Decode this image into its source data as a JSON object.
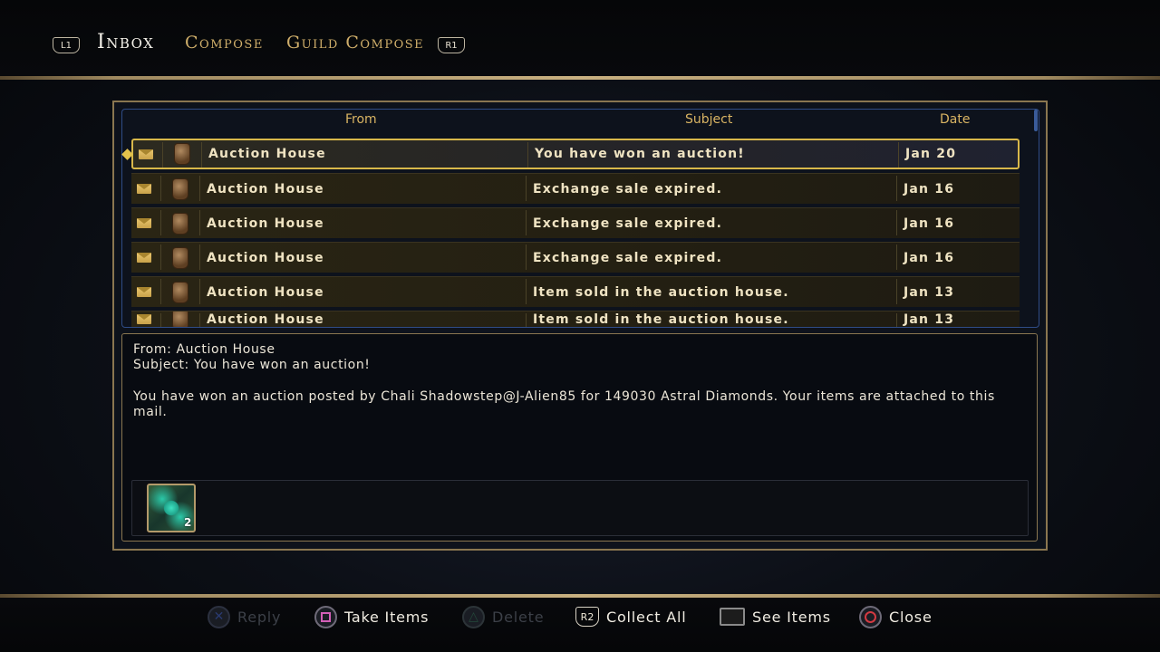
{
  "header": {
    "left_button": "L1",
    "right_button": "R1",
    "tabs": [
      {
        "label": "Inbox",
        "active": true
      },
      {
        "label": "Compose",
        "active": false
      },
      {
        "label": "Guild Compose",
        "active": false
      }
    ]
  },
  "list": {
    "columns": {
      "from": "From",
      "subject": "Subject",
      "date": "Date"
    },
    "rows": [
      {
        "from": "Auction House",
        "subject": "You have won an auction!",
        "date": "Jan 20",
        "selected": true
      },
      {
        "from": "Auction House",
        "subject": "Exchange sale expired.",
        "date": "Jan 16"
      },
      {
        "from": "Auction House",
        "subject": "Exchange sale expired.",
        "date": "Jan 16"
      },
      {
        "from": "Auction House",
        "subject": "Exchange sale expired.",
        "date": "Jan 16"
      },
      {
        "from": "Auction House",
        "subject": "Item sold in the auction house.",
        "date": "Jan 13"
      },
      {
        "from": "Auction House",
        "subject": "Item sold in the auction house.",
        "date": "Jan 13"
      }
    ]
  },
  "message": {
    "from_line": "From: Auction House",
    "subject_line": "Subject: You have won an auction!",
    "body": "You have won an auction posted by Chali Shadowstep@J-Alien85 for 149030 Astral Diamonds. Your items are attached to this mail.",
    "attachment": {
      "count": "2"
    }
  },
  "actions": {
    "reply": {
      "label": "Reply",
      "button": "✕",
      "enabled": false
    },
    "take_items": {
      "label": "Take Items",
      "enabled": true
    },
    "delete": {
      "label": "Delete",
      "button": "△",
      "enabled": false
    },
    "collect_all": {
      "label": "Collect All",
      "button": "R2",
      "enabled": true
    },
    "see_items": {
      "label": "See Items",
      "enabled": true
    },
    "close": {
      "label": "Close",
      "enabled": true
    }
  }
}
